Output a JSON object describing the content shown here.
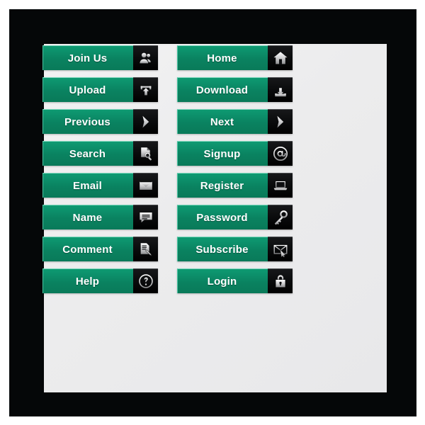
{
  "artwork": {
    "title": "Green web button set",
    "frame_color": "#050708",
    "panel_color": "#ececed",
    "button_green": "#0a8260",
    "button_green_light": "#0e9a72",
    "icon_box_color": "#000000",
    "label_color": "#ffffff",
    "highlight_color": "#7fd9be"
  },
  "columns": [
    {
      "name": "left-column",
      "buttons": [
        {
          "label": "Join Us",
          "icon": "users-icon"
        },
        {
          "label": "Upload",
          "icon": "upload-arrow-icon"
        },
        {
          "label": "Previous",
          "icon": "chevron-right-icon"
        },
        {
          "label": "Search",
          "icon": "document-magnifier-icon"
        },
        {
          "label": "Email",
          "icon": "envelope-icon"
        },
        {
          "label": "Name",
          "icon": "speech-bubble-icon"
        },
        {
          "label": "Comment",
          "icon": "document-pen-icon"
        },
        {
          "label": "Help",
          "icon": "question-mark-circle-icon"
        }
      ]
    },
    {
      "name": "right-column",
      "buttons": [
        {
          "label": "Home",
          "icon": "house-icon"
        },
        {
          "label": "Download",
          "icon": "download-arrow-icon"
        },
        {
          "label": "Next",
          "icon": "chevron-right-icon"
        },
        {
          "label": "Signup",
          "icon": "at-sign-icon"
        },
        {
          "label": "Register",
          "icon": "laptop-icon"
        },
        {
          "label": "Password",
          "icon": "key-icon"
        },
        {
          "label": "Subscribe",
          "icon": "envelope-cursor-icon"
        },
        {
          "label": "Login",
          "icon": "padlock-icon"
        }
      ]
    }
  ]
}
